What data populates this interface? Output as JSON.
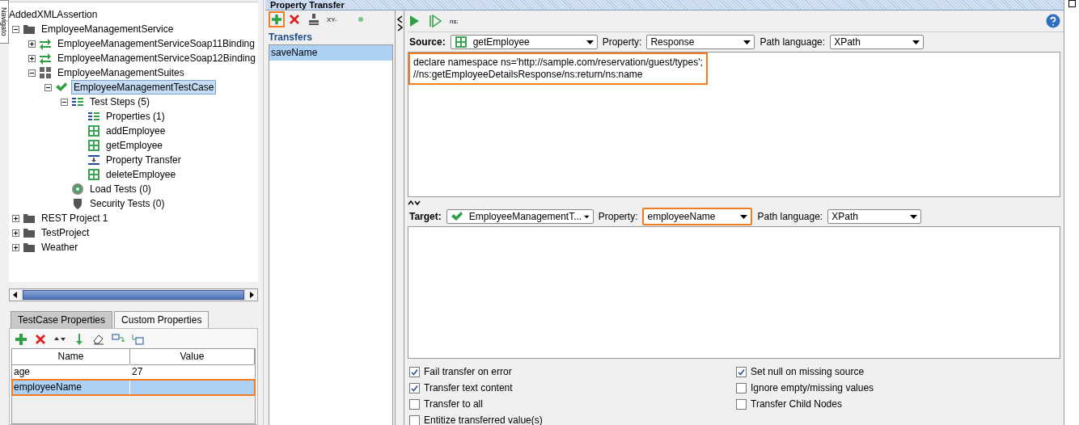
{
  "navigator_tab": {
    "label": "Navigato"
  },
  "tree": {
    "root": "AddedXMLAssertion",
    "items": [
      {
        "label": "EmployeeManagementService",
        "kind": "project",
        "expanded": true,
        "selected": false,
        "children": [
          {
            "label": "EmployeeManagementServiceSoap11Binding",
            "kind": "interface",
            "expanded": false,
            "selected": false
          },
          {
            "label": "EmployeeManagementServiceSoap12Binding",
            "kind": "interface",
            "expanded": false,
            "selected": false
          },
          {
            "label": "EmployeeManagementSuites",
            "kind": "suite",
            "expanded": true,
            "selected": false,
            "children": [
              {
                "label": "EmployeeManagementTestCase",
                "kind": "testcase",
                "expanded": true,
                "selected": true,
                "children": [
                  {
                    "label": "Test Steps (5)",
                    "kind": "steps",
                    "expanded": true,
                    "selected": false,
                    "children": [
                      {
                        "label": "Properties (1)",
                        "kind": "properties",
                        "selected": false
                      },
                      {
                        "label": "addEmployee",
                        "kind": "soap",
                        "selected": false
                      },
                      {
                        "label": "getEmployee",
                        "kind": "soap",
                        "selected": false
                      },
                      {
                        "label": "Property Transfer",
                        "kind": "transfer",
                        "selected": false
                      },
                      {
                        "label": "deleteEmployee",
                        "kind": "soap",
                        "selected": false
                      }
                    ]
                  },
                  {
                    "label": "Load Tests (0)",
                    "kind": "load",
                    "selected": false
                  },
                  {
                    "label": "Security Tests (0)",
                    "kind": "security",
                    "selected": false
                  }
                ]
              }
            ]
          }
        ]
      },
      {
        "label": "REST Project 1",
        "kind": "project",
        "expanded": false,
        "selected": false
      },
      {
        "label": "TestProject",
        "kind": "project",
        "expanded": false,
        "selected": false
      },
      {
        "label": "Weather",
        "kind": "project",
        "expanded": false,
        "selected": false
      }
    ]
  },
  "property_tabs": [
    {
      "label": "TestCase Properties",
      "selected": false
    },
    {
      "label": "Custom Properties",
      "selected": true
    }
  ],
  "properties_table": {
    "columns": [
      "Name",
      "Value"
    ],
    "rows": [
      {
        "name": "age",
        "value": "27",
        "selected": false,
        "highlighted": false
      },
      {
        "name": "employeeName",
        "selected": true,
        "highlighted": true
      }
    ]
  },
  "window": {
    "title": "Property Transfer"
  },
  "transfers_toolbar": {
    "add_highlighted": true,
    "label": "XY-"
  },
  "transfers": {
    "heading": "Transfers",
    "items": [
      {
        "label": "saveName",
        "selected": true
      }
    ]
  },
  "editor_toolbar": {
    "label": "ns:"
  },
  "source": {
    "label": "Source:",
    "step": {
      "label": "getEmployee",
      "kind": "soap"
    },
    "property_label": "Property:",
    "property": "Response",
    "property_highlighted": false,
    "path_label": "Path language:",
    "path_language": "XPath",
    "highlighted": true,
    "expression": [
      "declare namespace ns='http://sample.com/reservation/guest/types';",
      "//ns:getEmployeeDetailsResponse/ns:return/ns:name"
    ]
  },
  "target": {
    "label": "Target:",
    "step": {
      "label": "EmployeeManagementT...",
      "kind": "testcase"
    },
    "property_label": "Property:",
    "property": "employeeName",
    "property_highlighted": true,
    "path_label": "Path language:",
    "path_language": "XPath"
  },
  "options": [
    {
      "label": "Fail transfer on error",
      "checked": true
    },
    {
      "label": "Transfer text content",
      "checked": true
    },
    {
      "label": "Transfer to all",
      "checked": false
    },
    {
      "label": "Entitize transferred value(s)",
      "checked": false
    },
    {
      "label": "Set null on missing source",
      "checked": true
    },
    {
      "label": "Ignore empty/missing values",
      "checked": false
    },
    {
      "label": "Transfer Child Nodes",
      "checked": false
    }
  ]
}
